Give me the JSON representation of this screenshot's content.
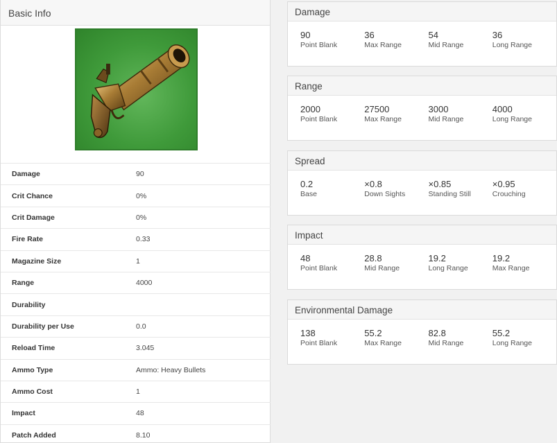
{
  "basic_info": {
    "title": "Basic Info",
    "image_icon": "flintlock-pistol-icon",
    "stats": [
      {
        "label": "Damage",
        "value": "90"
      },
      {
        "label": "Crit Chance",
        "value": "0%"
      },
      {
        "label": "Crit Damage",
        "value": "0%"
      },
      {
        "label": "Fire Rate",
        "value": "0.33"
      },
      {
        "label": "Magazine Size",
        "value": "1"
      },
      {
        "label": "Range",
        "value": "4000"
      },
      {
        "label": "Durability",
        "value": ""
      },
      {
        "label": "Durability per Use",
        "value": "0.0"
      },
      {
        "label": "Reload Time",
        "value": "3.045"
      },
      {
        "label": "Ammo Type",
        "value": "Ammo: Heavy Bullets"
      },
      {
        "label": "Ammo Cost",
        "value": "1"
      },
      {
        "label": "Impact",
        "value": "48"
      },
      {
        "label": "Patch Added",
        "value": "8.10"
      }
    ]
  },
  "cards": [
    {
      "title": "Damage",
      "cells": [
        {
          "value": "90",
          "label": "Point Blank"
        },
        {
          "value": "36",
          "label": "Max Range"
        },
        {
          "value": "54",
          "label": "Mid Range"
        },
        {
          "value": "36",
          "label": "Long Range"
        }
      ]
    },
    {
      "title": "Range",
      "cells": [
        {
          "value": "2000",
          "label": "Point Blank"
        },
        {
          "value": "27500",
          "label": "Max Range"
        },
        {
          "value": "3000",
          "label": "Mid Range"
        },
        {
          "value": "4000",
          "label": "Long Range"
        }
      ]
    },
    {
      "title": "Spread",
      "cells": [
        {
          "value": "0.2",
          "label": "Base"
        },
        {
          "value": "×0.8",
          "label": "Down Sights"
        },
        {
          "value": "×0.85",
          "label": "Standing Still"
        },
        {
          "value": "×0.95",
          "label": "Crouching"
        }
      ]
    },
    {
      "title": "Impact",
      "cells": [
        {
          "value": "48",
          "label": "Point Blank"
        },
        {
          "value": "28.8",
          "label": "Mid Range"
        },
        {
          "value": "19.2",
          "label": "Long Range"
        },
        {
          "value": "19.2",
          "label": "Max Range"
        }
      ]
    },
    {
      "title": "Environmental Damage",
      "cells": [
        {
          "value": "138",
          "label": "Point Blank"
        },
        {
          "value": "55.2",
          "label": "Max Range"
        },
        {
          "value": "82.8",
          "label": "Mid Range"
        },
        {
          "value": "55.2",
          "label": "Long Range"
        }
      ]
    }
  ]
}
